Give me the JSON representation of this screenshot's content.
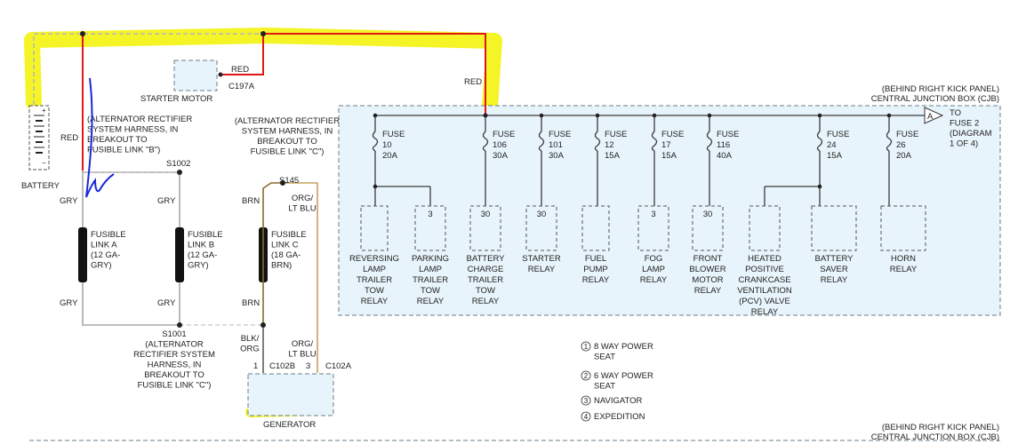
{
  "labels": {
    "red_top": "RED",
    "red_left": "RED",
    "red_cjb": "RED",
    "starter_motor": "STARTER MOTOR",
    "c197a": "C197A",
    "battery": "BATTERY",
    "alt_harness_b": [
      "(ALTERNATOR RECTIFIER",
      "SYSTEM HARNESS, IN",
      "BREAKOUT TO",
      "FUSIBLE LINK \"B\")"
    ],
    "alt_harness_c_top": [
      "(ALTERNATOR RECTIFIER",
      "SYSTEM HARNESS, IN",
      "BREAKOUT TO",
      "FUSIBLE LINK \"C\")"
    ],
    "alt_harness_c_bottom": [
      "S1001",
      "(ALTERNATOR",
      "RECTIFIER SYSTEM",
      "HARNESS, IN",
      "BREAKOUT TO",
      "FUSIBLE LINK \"C\")"
    ],
    "s1002": "S1002",
    "s145": "S145",
    "gry": "GRY",
    "brn": "BRN",
    "org_lt_blu": [
      "ORG/",
      "LT BLU"
    ],
    "blk_org": [
      "BLK/",
      "ORG"
    ],
    "fusible_a": [
      "FUSIBLE",
      "LINK A",
      "(12 GA-",
      "GRY)"
    ],
    "fusible_b": [
      "FUSIBLE",
      "LINK B",
      "(12 GA-",
      "GRY)"
    ],
    "fusible_c": [
      "FUSIBLE",
      "LINK C",
      "(18 GA-",
      "BRN)"
    ],
    "pin1": "1",
    "pin3": "3",
    "c102b": "C102B",
    "c102a": "C102A",
    "generator": "GENERATOR",
    "cjb_title": [
      "(BEHIND RIGHT KICK PANEL)",
      "CENTRAL JUNCTION BOX (CJB)"
    ],
    "to_fuse2": [
      "TO",
      "FUSE 2",
      "(DIAGRAM",
      "1 OF 4)"
    ],
    "connector_a": "A"
  },
  "fuses": [
    {
      "name": "FUSE",
      "num": "10",
      "amp": "20A"
    },
    {
      "name": "FUSE",
      "num": "106",
      "amp": "30A"
    },
    {
      "name": "FUSE",
      "num": "101",
      "amp": "30A"
    },
    {
      "name": "FUSE",
      "num": "12",
      "amp": "15A"
    },
    {
      "name": "FUSE",
      "num": "17",
      "amp": "15A"
    },
    {
      "name": "FUSE",
      "num": "116",
      "amp": "40A"
    },
    {
      "name": "FUSE",
      "num": "24",
      "amp": "15A"
    },
    {
      "name": "FUSE",
      "num": "26",
      "amp": "20A"
    }
  ],
  "relays": [
    {
      "pin": "",
      "label": [
        "REVERSING",
        "LAMP",
        "TRAILER",
        "TOW",
        "RELAY"
      ]
    },
    {
      "pin": "3",
      "label": [
        "PARKING",
        "LAMP",
        "TRAILER",
        "TOW",
        "RELAY"
      ]
    },
    {
      "pin": "30",
      "label": [
        "BATTERY",
        "CHARGE",
        "TRAILER",
        "TOW",
        "RELAY"
      ]
    },
    {
      "pin": "30",
      "label": [
        "STARTER",
        "RELAY"
      ]
    },
    {
      "pin": "",
      "label": [
        "FUEL",
        "PUMP",
        "RELAY"
      ]
    },
    {
      "pin": "3",
      "label": [
        "FOG",
        "LAMP",
        "RELAY"
      ]
    },
    {
      "pin": "30",
      "label": [
        "FRONT",
        "BLOWER",
        "MOTOR",
        "RELAY"
      ]
    },
    {
      "pin": "",
      "label": [
        "HEATED",
        "POSITIVE",
        "CRANKCASE",
        "VENTILATION",
        "(PCV) VALVE",
        "RELAY"
      ]
    },
    {
      "pin": "",
      "label": [
        "BATTERY",
        "SAVER",
        "RELAY"
      ]
    },
    {
      "pin": "",
      "label": [
        "HORN",
        "RELAY"
      ]
    }
  ],
  "legend": [
    {
      "num": "1",
      "text": [
        "8 WAY POWER",
        "SEAT"
      ]
    },
    {
      "num": "2",
      "text": [
        "6 WAY POWER",
        "SEAT"
      ]
    },
    {
      "num": "3",
      "text": [
        "NAVIGATOR"
      ]
    },
    {
      "num": "4",
      "text": [
        "EXPEDITION"
      ]
    }
  ],
  "highlight_color": "#f2f200",
  "annotation_color": "#1a2ad6"
}
